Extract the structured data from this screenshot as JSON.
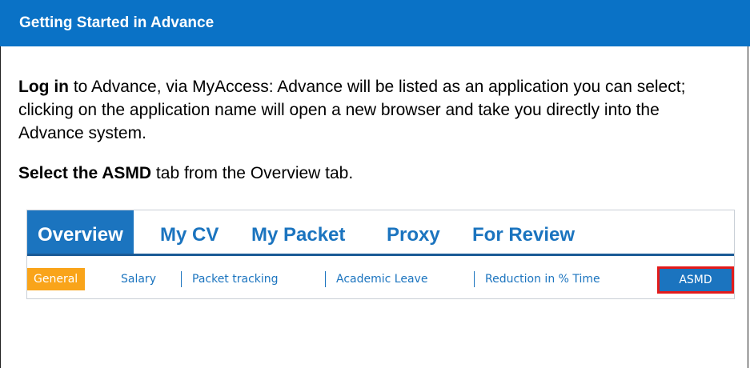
{
  "header": {
    "title": "Getting Started in Advance"
  },
  "paragraph1": {
    "bold": "Log in",
    "rest": " to Advance, via MyAccess: Advance will be listed as an application you can select; clicking on the application name will open a new browser and take you directly into the Advance system."
  },
  "paragraph2": {
    "bold": "Select the ASMD",
    "rest": " tab from the Overview tab."
  },
  "screenshot": {
    "tabs": [
      "Overview",
      "My CV",
      "My Packet",
      "Proxy",
      "For Review"
    ],
    "subtabs": [
      "General",
      "Salary",
      "Packet tracking",
      "Academic Leave",
      "Reduction in % Time",
      "ASMD"
    ],
    "colors": {
      "primary": "#1b74bf",
      "active_subtab": "#f9a41a",
      "highlight": "#e31b1b",
      "header": "#0a72c6"
    }
  }
}
